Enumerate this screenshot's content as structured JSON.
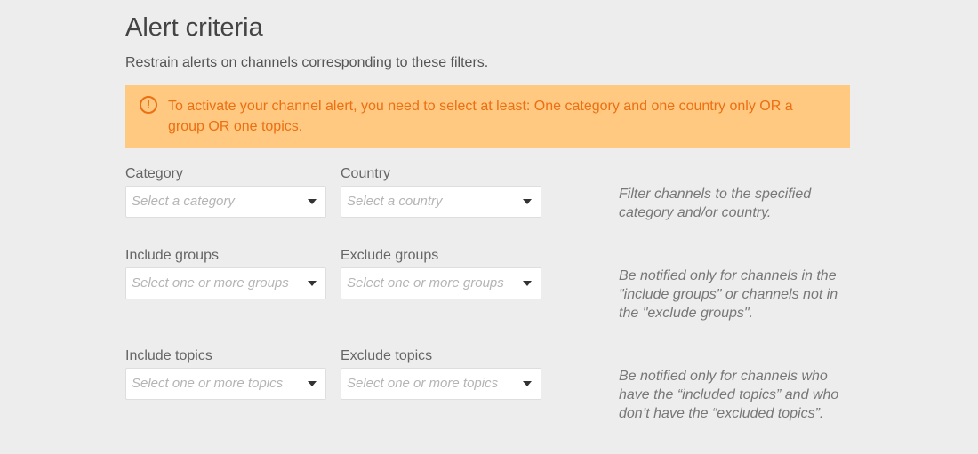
{
  "header": {
    "title": "Alert criteria",
    "subtitle": "Restrain alerts on channels corresponding to these filters."
  },
  "alert": {
    "icon": "exclamation-circle-icon",
    "text": "To activate your channel alert, you need to select at least: One category and one country only OR a group OR one topics."
  },
  "filters": {
    "category": {
      "label": "Category",
      "placeholder": "Select a category"
    },
    "country": {
      "label": "Country",
      "placeholder": "Select a country"
    },
    "category_country_help": "Filter channels to the specified category and/or country.",
    "include_groups": {
      "label": "Include groups",
      "placeholder": "Select one or more groups"
    },
    "exclude_groups": {
      "label": "Exclude groups",
      "placeholder": "Select one or more groups"
    },
    "groups_help": "Be notified only for channels in the \"include groups\" or channels not in the \"exclude groups\".",
    "include_topics": {
      "label": "Include topics",
      "placeholder": "Select one or more topics"
    },
    "exclude_topics": {
      "label": "Exclude topics",
      "placeholder": "Select one or more topics"
    },
    "topics_help": "Be notified only for channels who have the “included topics” and who don’t have the “excluded topics”."
  },
  "colors": {
    "background": "#ededed",
    "alert_background": "#ffc982",
    "alert_text": "#ec6f12"
  }
}
